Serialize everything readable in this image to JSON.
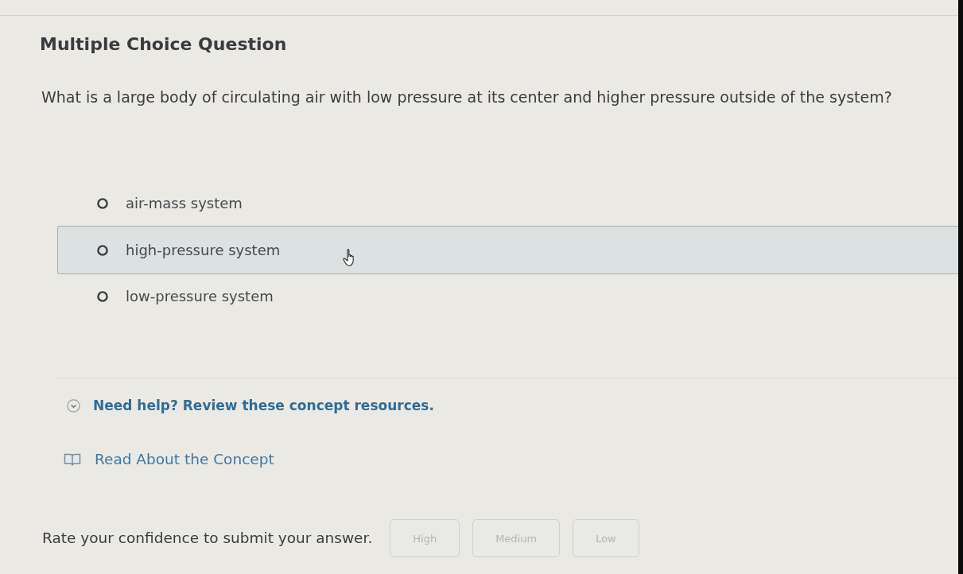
{
  "header": {
    "title": "Multiple Choice Question"
  },
  "question": {
    "text": "What is a large body of circulating air with low pressure at its center and higher pressure outside of the system?"
  },
  "options": [
    {
      "label": "air-mass system",
      "selected": false,
      "hovered": false
    },
    {
      "label": "high-pressure system",
      "selected": false,
      "hovered": true
    },
    {
      "label": "low-pressure system",
      "selected": false,
      "hovered": false
    }
  ],
  "help": {
    "toggle": "Need help? Review these concept resources.",
    "resources": [
      {
        "label": "Read About the Concept"
      }
    ]
  },
  "confidence": {
    "prompt": "Rate your confidence to submit your answer.",
    "buttons": [
      {
        "label": "High",
        "disabled": true
      },
      {
        "label": "Medium",
        "disabled": true
      },
      {
        "label": "Low",
        "disabled": true
      }
    ]
  }
}
